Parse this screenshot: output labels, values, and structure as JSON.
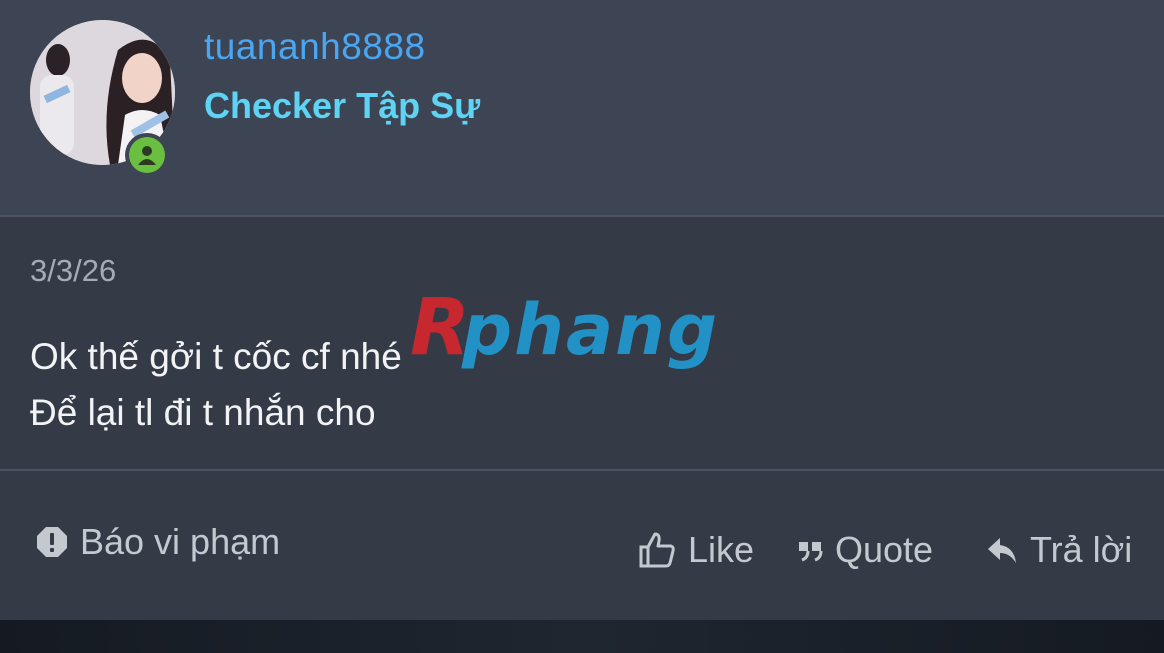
{
  "user": {
    "username": "tuananh8888",
    "title": "Checker Tập Sự",
    "status": "online"
  },
  "post": {
    "date": "3/3/26",
    "lines": [
      "Ok thế gởi t cốc cf nhé",
      "Để lại tl đi t nhắn cho"
    ]
  },
  "watermark": {
    "text": "Rphang"
  },
  "actions": {
    "report": "Báo vi phạm",
    "like": "Like",
    "quote": "Quote",
    "reply": "Trả lời"
  },
  "colors": {
    "username": "#4aa6f0",
    "title": "#5fd3f3",
    "online": "#6abf40",
    "header_bg": "#3d4454",
    "body_bg": "#353a47"
  },
  "icons": {
    "report": "exclamation-icon",
    "like": "thumbs-up-icon",
    "quote": "quote-icon",
    "reply": "reply-icon",
    "status": "user-icon"
  }
}
